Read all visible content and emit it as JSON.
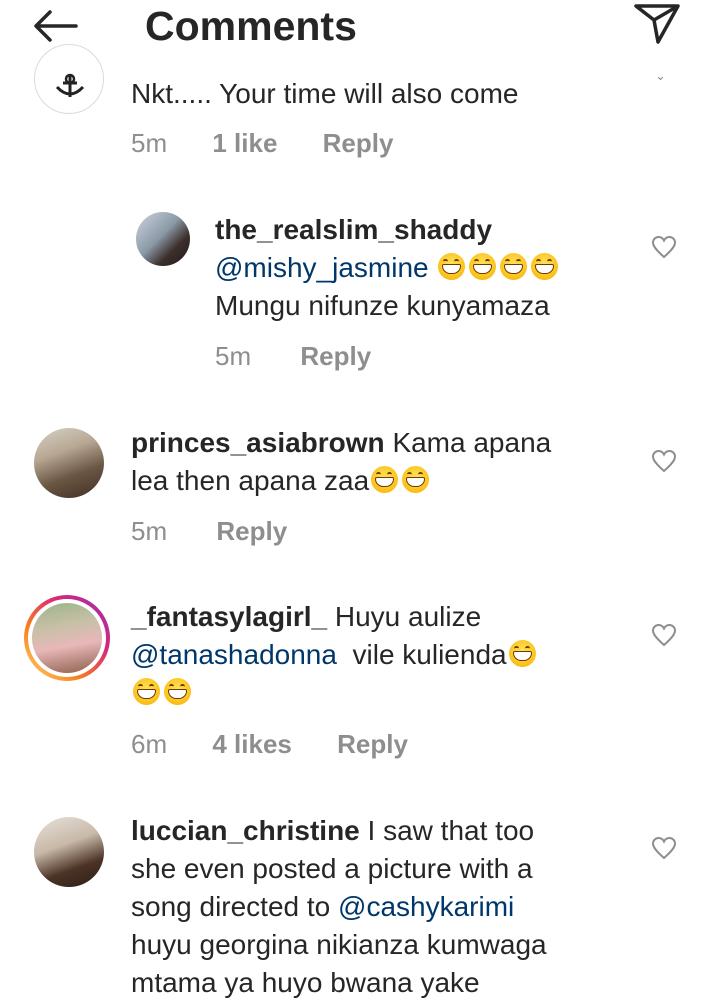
{
  "header": {
    "title": "Comments",
    "back_icon": "back-arrow-icon",
    "send_icon": "direct-send-icon"
  },
  "colors": {
    "mention": "#00376b",
    "secondary_text": "#8e8e8e",
    "primary_text": "#262626",
    "story_ring": "#d62976"
  },
  "comments": [
    {
      "text": "Nkt..... Your time will also come",
      "time": "5m",
      "likes": "1 like",
      "reply": "Reply"
    },
    {
      "username": "the_realslim_shaddy",
      "mention": "@mishy_jasmine",
      "emoji_count": 4,
      "text": "Mungu nifunze kunyamaza",
      "time": "5m",
      "reply": "Reply"
    },
    {
      "username": "princes_asiabrown",
      "text_part1": "Kama apana",
      "text_part2": "lea then apana zaa",
      "emoji_count": 2,
      "time": "5m",
      "reply": "Reply"
    },
    {
      "username": "_fantasylagirl_",
      "text_part1": "Huyu aulize",
      "mention": "@tanashadonna",
      "text_part2": "vile kulienda",
      "emoji_count": 3,
      "time": "6m",
      "likes": "4 likes",
      "reply": "Reply"
    },
    {
      "username": "luccian_christine",
      "line1": "I saw that too",
      "line2": "she even posted a picture with a",
      "line3": "song directed to",
      "mention": "@cashykarimi",
      "line4": "huyu georgina nikianza kumwaga",
      "line5": "mtama ya huyo bwana yake"
    }
  ]
}
